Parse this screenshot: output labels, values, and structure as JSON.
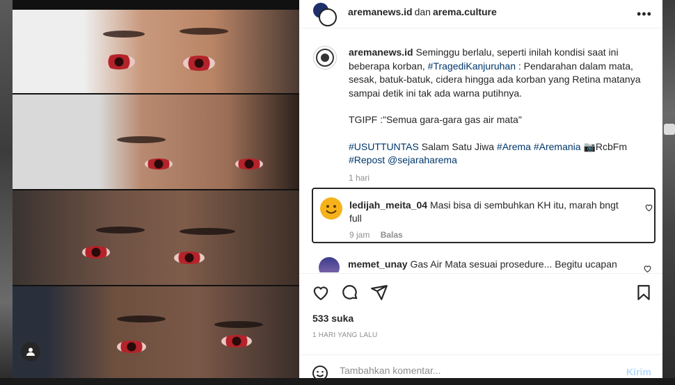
{
  "colors": {
    "hashtag": "#00376b",
    "text": "#262626",
    "muted": "#8e8e8e",
    "post_button": "#b3dbff",
    "highlight_border": "#262626"
  },
  "header": {
    "account": "aremanews.id",
    "separator": "dan",
    "collaborator": "arema.culture",
    "more_icon": "more-horizontal-icon"
  },
  "caption": {
    "username": "aremanews.id",
    "text1": "Seminggu berlalu, seperti inilah kondisi saat ini beberapa korban,",
    "tag1": "#TragediKanjuruhan",
    "text2": ": Pendarahan dalam mata, sesak, batuk-batuk, cidera hingga ada korban yang Retina matanya sampai detik ini tak ada warna putihnya.",
    "quote": "TGIPF :\"Semua gara-gara gas air mata\"",
    "tag2": "#USUTTUNTAS",
    "text3": "Salam Satu Jiwa",
    "tag3": "#Arema",
    "tag4": "#Aremania",
    "credit": "📷RcbFm",
    "tag5": "#Repost",
    "mention": "@sejaraharema",
    "time": "1 hari"
  },
  "comments": [
    {
      "username": "ledijah_meita_04",
      "text": "Masi bisa di sembuhkan KH itu, marah bngt full",
      "time": "9 jam",
      "reply": "Balas"
    },
    {
      "username": "memet_unay",
      "text": "Gas Air Mata sesuai prosedure... Begitu ucapan"
    }
  ],
  "actions": {
    "like": "heart-icon",
    "comment": "comment-icon",
    "share": "send-icon",
    "save": "bookmark-icon"
  },
  "likes": "533 suka",
  "posted": "1 HARI YANG LALU",
  "add_comment": {
    "placeholder": "Tambahkan komentar...",
    "post_label": "Kirim"
  }
}
